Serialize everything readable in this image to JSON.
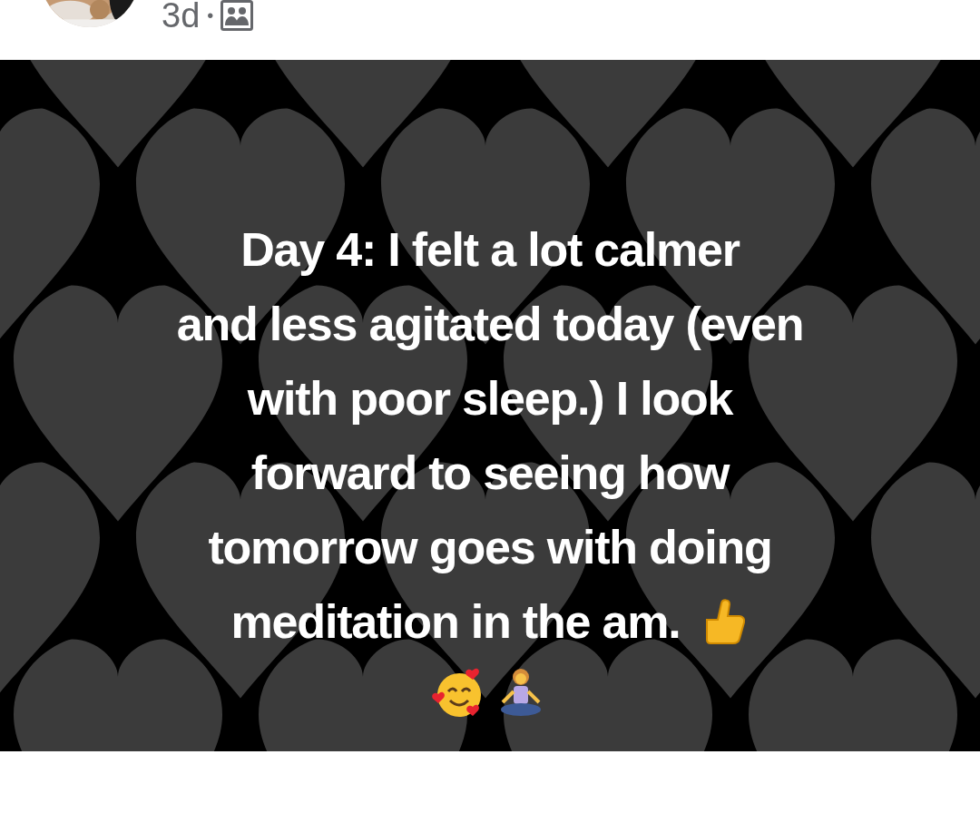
{
  "post": {
    "age": "3d",
    "separator": "•",
    "image": {
      "lines": [
        "Day 4: I felt a lot calmer",
        "and less agitated today (even",
        "with poor sleep.) I look",
        "forward to seeing how",
        "tomorrow goes with doing",
        "meditation in the am."
      ]
    }
  }
}
